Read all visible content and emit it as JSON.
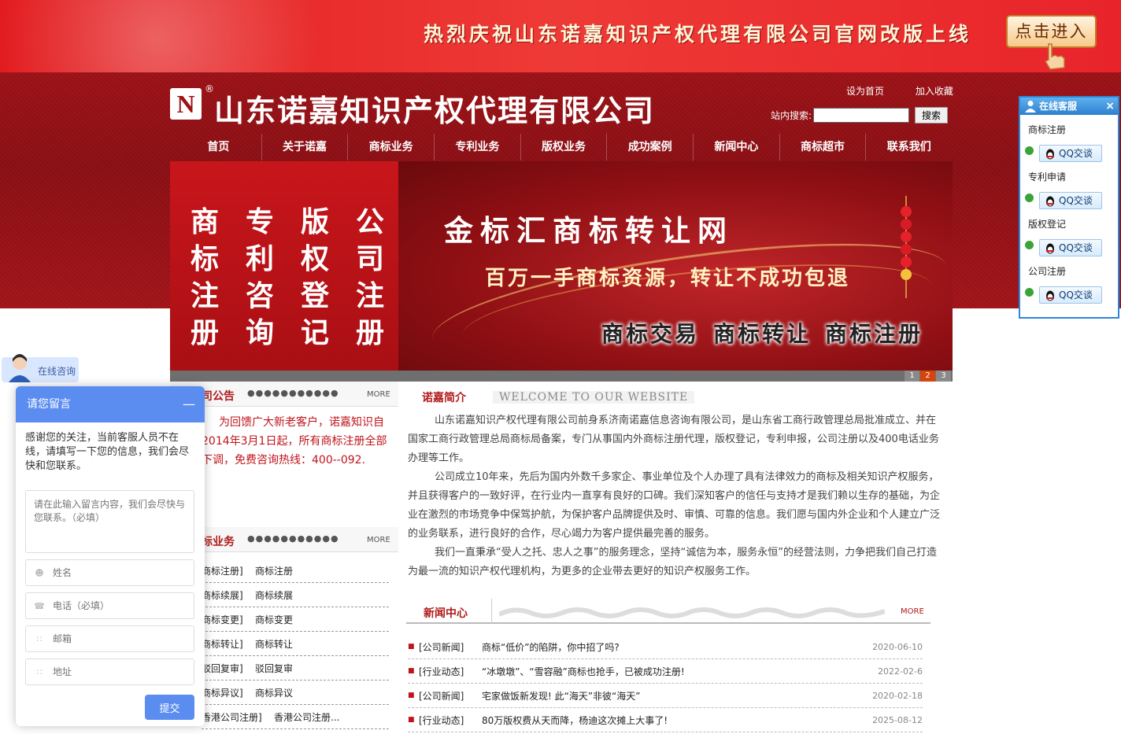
{
  "promo": {
    "text": "热烈庆祝山东诺嘉知识产权代理有限公司官网改版上线",
    "button": "点击进入"
  },
  "header": {
    "logo_letter": "N",
    "reg_mark": "®",
    "site_title": "山东诺嘉知识产权代理有限公司",
    "set_home": "设为首页",
    "add_favorite": "加入收藏",
    "search_label": "站内搜索:",
    "search_value": "",
    "search_button": "搜索"
  },
  "nav": [
    "首页",
    "关于诺嘉",
    "商标业务",
    "专利业务",
    "版权业务",
    "成功案例",
    "新闻中心",
    "商标超市",
    "联系我们"
  ],
  "banner": {
    "columns": [
      [
        "商",
        "标",
        "注",
        "册"
      ],
      [
        "专",
        "利",
        "咨",
        "询"
      ],
      [
        "版",
        "权",
        "登",
        "记"
      ],
      [
        "公",
        "司",
        "注",
        "册"
      ]
    ],
    "title": "金标汇商标转让网",
    "subtitle": "百万一手商标资源，转让不成功包退",
    "tags": [
      "商标交易",
      "商标转让",
      "商标注册"
    ],
    "pages": [
      "1",
      "2",
      "3"
    ],
    "active_page": "2"
  },
  "notice": {
    "title": "司公告",
    "dots": "●●●●●●●●●●●",
    "more": "MORE",
    "text": "为回馈广大新老客户，诺嘉知识自2014年3月1日起，所有商标注册全部下调，免费咨询热线：400--092."
  },
  "business": {
    "title": "标业务",
    "dots": "●●●●●●●●●●●",
    "more": "MORE",
    "rows": [
      {
        "k": "商标注册]",
        "v": "商标注册"
      },
      {
        "k": "商标续展]",
        "v": "商标续展"
      },
      {
        "k": "商标变更]",
        "v": "商标变更"
      },
      {
        "k": "商标转让]",
        "v": "商标转让"
      },
      {
        "k": "驳回复审]",
        "v": "驳回复审"
      },
      {
        "k": "商标异议]",
        "v": "商标异议"
      },
      {
        "k": "香港公司注册]",
        "v": "香港公司注册..."
      }
    ]
  },
  "intro": {
    "title": "诺嘉简介",
    "en": "WELCOME TO OUR WEBSITE",
    "paragraphs": [
      "山东诺嘉知识产权代理有限公司前身系济南诺嘉信息咨询有限公司，是山东省工商行政管理总局批准成立、并在国家工商行政管理总局商标局备案，专门从事国内外商标注册代理，版权登记，专利申报，公司注册以及400电话业务办理等工作。",
      "公司成立10年来，先后为国内外数千多家企、事业单位及个人办理了具有法律效力的商标及相关知识产权服务，并且获得客户的一致好评，在行业内一直享有良好的口碑。我们深知客户的信任与支持才是我们赖以生存的基础，为企业在激烈的市场竞争中保驾护航，为保护客户品牌提供及时、审慎、可靠的信息。我们愿与国内外企业和个人建立广泛的业务联系，进行良好的合作，尽心竭力为客户提供最完善的服务。",
      "我们一直秉承“受人之托、忠人之事”的服务理念，坚持“诚信为本，服务永恒”的经营法则，力争把我们自己打造为最一流的知识产权代理机构，为更多的企业带去更好的知识产权服务工作。"
    ]
  },
  "news": {
    "title": "新闻中心",
    "more": "MORE",
    "rows": [
      {
        "cat": "[公司新闻]",
        "title": "商标“低价”的陷阱，你中招了吗?",
        "date": "2020-06-10"
      },
      {
        "cat": "[行业动态]",
        "title": "“冰墩墩”、“雪容融”商标也抢手，已被成功注册!",
        "date": "2022-02-6"
      },
      {
        "cat": "[公司新闻]",
        "title": "宅家做饭新发现! 此“海天”非彼“海天”",
        "date": "2020-02-18"
      },
      {
        "cat": "[行业动态]",
        "title": "80万版权费从天而降，杨迪这次摊上大事了!",
        "date": "2025-08-12"
      }
    ]
  },
  "qq_panel": {
    "title": "在线客服",
    "close": "×",
    "groups": [
      {
        "label": "商标注册",
        "button": "QQ交谈"
      },
      {
        "label": "专利申请",
        "button": "QQ交谈"
      },
      {
        "label": "版权登记",
        "button": "QQ交谈"
      },
      {
        "label": "公司注册",
        "button": "QQ交谈"
      }
    ]
  },
  "consult": {
    "tab_label": "在线咨询"
  },
  "message": {
    "title": "请您留言",
    "minimize": "—",
    "intro": "感谢您的关注，当前客服人员不在线，请填写一下您的信息，我们会尽快和您联系。",
    "content_placeholder": "请在此输入留言内容，我们会尽快与您联系。（必填）",
    "name_placeholder": "姓名",
    "phone_placeholder": "电话（必填）",
    "email_placeholder": "邮箱",
    "address_placeholder": "地址",
    "submit": "提交"
  },
  "colors": {
    "brand_red": "#9d1217",
    "accent_blue": "#5b8df0",
    "qq_blue": "#2d87d6"
  }
}
